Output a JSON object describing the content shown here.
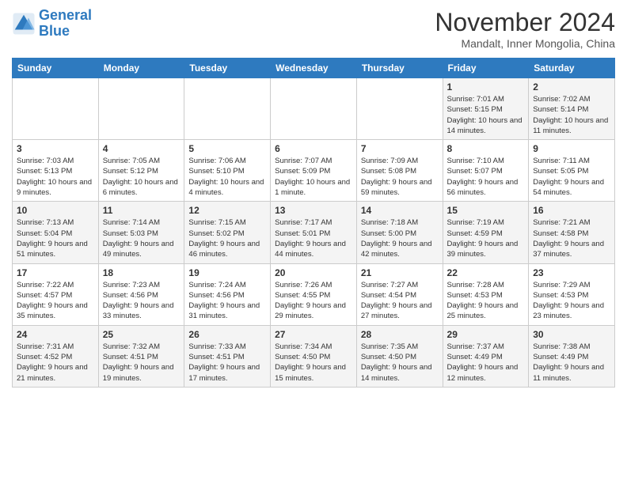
{
  "header": {
    "logo_line1": "General",
    "logo_line2": "Blue",
    "month": "November 2024",
    "location": "Mandalt, Inner Mongolia, China"
  },
  "weekdays": [
    "Sunday",
    "Monday",
    "Tuesday",
    "Wednesday",
    "Thursday",
    "Friday",
    "Saturday"
  ],
  "weeks": [
    [
      {
        "day": "",
        "info": ""
      },
      {
        "day": "",
        "info": ""
      },
      {
        "day": "",
        "info": ""
      },
      {
        "day": "",
        "info": ""
      },
      {
        "day": "",
        "info": ""
      },
      {
        "day": "1",
        "info": "Sunrise: 7:01 AM\nSunset: 5:15 PM\nDaylight: 10 hours and 14 minutes."
      },
      {
        "day": "2",
        "info": "Sunrise: 7:02 AM\nSunset: 5:14 PM\nDaylight: 10 hours and 11 minutes."
      }
    ],
    [
      {
        "day": "3",
        "info": "Sunrise: 7:03 AM\nSunset: 5:13 PM\nDaylight: 10 hours and 9 minutes."
      },
      {
        "day": "4",
        "info": "Sunrise: 7:05 AM\nSunset: 5:12 PM\nDaylight: 10 hours and 6 minutes."
      },
      {
        "day": "5",
        "info": "Sunrise: 7:06 AM\nSunset: 5:10 PM\nDaylight: 10 hours and 4 minutes."
      },
      {
        "day": "6",
        "info": "Sunrise: 7:07 AM\nSunset: 5:09 PM\nDaylight: 10 hours and 1 minute."
      },
      {
        "day": "7",
        "info": "Sunrise: 7:09 AM\nSunset: 5:08 PM\nDaylight: 9 hours and 59 minutes."
      },
      {
        "day": "8",
        "info": "Sunrise: 7:10 AM\nSunset: 5:07 PM\nDaylight: 9 hours and 56 minutes."
      },
      {
        "day": "9",
        "info": "Sunrise: 7:11 AM\nSunset: 5:05 PM\nDaylight: 9 hours and 54 minutes."
      }
    ],
    [
      {
        "day": "10",
        "info": "Sunrise: 7:13 AM\nSunset: 5:04 PM\nDaylight: 9 hours and 51 minutes."
      },
      {
        "day": "11",
        "info": "Sunrise: 7:14 AM\nSunset: 5:03 PM\nDaylight: 9 hours and 49 minutes."
      },
      {
        "day": "12",
        "info": "Sunrise: 7:15 AM\nSunset: 5:02 PM\nDaylight: 9 hours and 46 minutes."
      },
      {
        "day": "13",
        "info": "Sunrise: 7:17 AM\nSunset: 5:01 PM\nDaylight: 9 hours and 44 minutes."
      },
      {
        "day": "14",
        "info": "Sunrise: 7:18 AM\nSunset: 5:00 PM\nDaylight: 9 hours and 42 minutes."
      },
      {
        "day": "15",
        "info": "Sunrise: 7:19 AM\nSunset: 4:59 PM\nDaylight: 9 hours and 39 minutes."
      },
      {
        "day": "16",
        "info": "Sunrise: 7:21 AM\nSunset: 4:58 PM\nDaylight: 9 hours and 37 minutes."
      }
    ],
    [
      {
        "day": "17",
        "info": "Sunrise: 7:22 AM\nSunset: 4:57 PM\nDaylight: 9 hours and 35 minutes."
      },
      {
        "day": "18",
        "info": "Sunrise: 7:23 AM\nSunset: 4:56 PM\nDaylight: 9 hours and 33 minutes."
      },
      {
        "day": "19",
        "info": "Sunrise: 7:24 AM\nSunset: 4:56 PM\nDaylight: 9 hours and 31 minutes."
      },
      {
        "day": "20",
        "info": "Sunrise: 7:26 AM\nSunset: 4:55 PM\nDaylight: 9 hours and 29 minutes."
      },
      {
        "day": "21",
        "info": "Sunrise: 7:27 AM\nSunset: 4:54 PM\nDaylight: 9 hours and 27 minutes."
      },
      {
        "day": "22",
        "info": "Sunrise: 7:28 AM\nSunset: 4:53 PM\nDaylight: 9 hours and 25 minutes."
      },
      {
        "day": "23",
        "info": "Sunrise: 7:29 AM\nSunset: 4:53 PM\nDaylight: 9 hours and 23 minutes."
      }
    ],
    [
      {
        "day": "24",
        "info": "Sunrise: 7:31 AM\nSunset: 4:52 PM\nDaylight: 9 hours and 21 minutes."
      },
      {
        "day": "25",
        "info": "Sunrise: 7:32 AM\nSunset: 4:51 PM\nDaylight: 9 hours and 19 minutes."
      },
      {
        "day": "26",
        "info": "Sunrise: 7:33 AM\nSunset: 4:51 PM\nDaylight: 9 hours and 17 minutes."
      },
      {
        "day": "27",
        "info": "Sunrise: 7:34 AM\nSunset: 4:50 PM\nDaylight: 9 hours and 15 minutes."
      },
      {
        "day": "28",
        "info": "Sunrise: 7:35 AM\nSunset: 4:50 PM\nDaylight: 9 hours and 14 minutes."
      },
      {
        "day": "29",
        "info": "Sunrise: 7:37 AM\nSunset: 4:49 PM\nDaylight: 9 hours and 12 minutes."
      },
      {
        "day": "30",
        "info": "Sunrise: 7:38 AM\nSunset: 4:49 PM\nDaylight: 9 hours and 11 minutes."
      }
    ]
  ]
}
